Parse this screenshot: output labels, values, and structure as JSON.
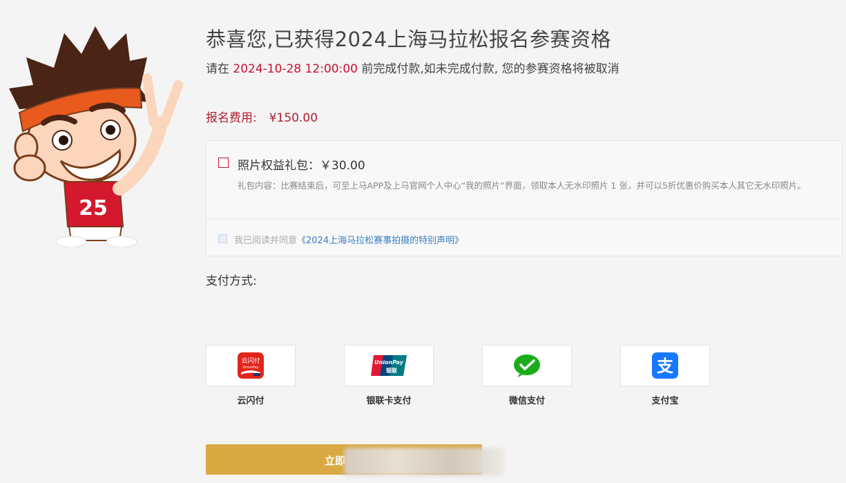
{
  "header": {
    "title": "恭喜您,已获得2024上海马拉松报名参赛资格",
    "deadline_prefix": "请在",
    "deadline_time": "2024-10-28 12:00:00",
    "deadline_suffix": "前完成付款,如未完成付款, 您的参赛资格将被取消"
  },
  "mascot": {
    "bib_number": "25"
  },
  "fee": {
    "label": "报名费用:",
    "amount": "¥150.00"
  },
  "package": {
    "checked": false,
    "title": "照片权益礼包：￥30.00",
    "description": "礼包内容：比赛结束后，可至上马APP及上马官网个人中心“我的照片”界面，领取本人无水印照片 1 张，并可以5折优惠价购买本人其它无水印照片。"
  },
  "agreement": {
    "checked": false,
    "prefix": "我已阅读并同意",
    "link_text": "《2024上海马拉松赛事拍摄的特别声明》"
  },
  "payment": {
    "label": "支付方式:",
    "methods": [
      {
        "name": "云闪付",
        "icon": "unionpay-quickpass-icon",
        "icon_text": "云闪付",
        "icon_subtext": "UnionPay"
      },
      {
        "name": "银联卡支付",
        "icon": "unionpay-card-icon",
        "icon_text": "UnionPay",
        "icon_subtext": "银联"
      },
      {
        "name": "微信支付",
        "icon": "wechat-pay-icon"
      },
      {
        "name": "支付宝",
        "icon": "alipay-icon",
        "icon_text": "支"
      }
    ]
  },
  "submit": {
    "label": "立即"
  },
  "colors": {
    "accent_red": "#c8102e",
    "button_gold": "#d9a944",
    "link_blue": "#3a7fc1",
    "wechat_green": "#1aad19",
    "alipay_blue": "#1677ff"
  }
}
